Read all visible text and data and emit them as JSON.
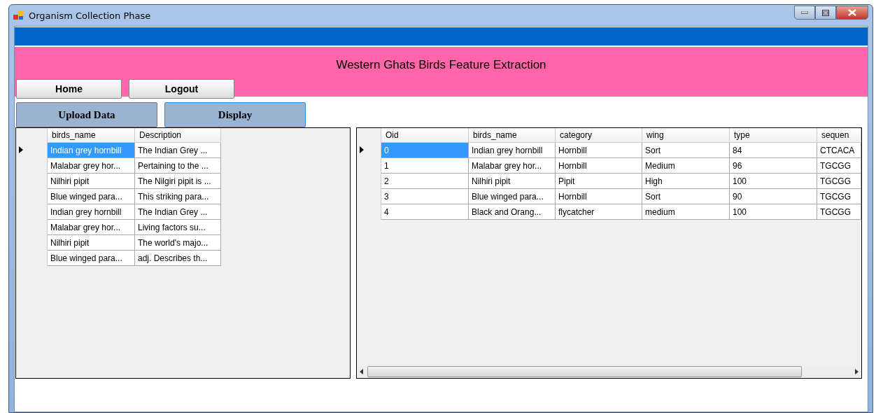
{
  "window": {
    "title": "Organism Collection Phase"
  },
  "header": {
    "title": "Western Ghats Birds Feature Extraction"
  },
  "nav_buttons": [
    "Home",
    "Logout"
  ],
  "action_buttons": [
    "Upload Data",
    "Display"
  ],
  "left_table": {
    "columns": [
      "birds_name",
      "Description"
    ],
    "rows": [
      {
        "selected": true,
        "cells": [
          "Indian grey hornbill",
          "The Indian Grey ..."
        ]
      },
      {
        "selected": false,
        "cells": [
          "Malabar grey hor...",
          "Pertaining to the ..."
        ]
      },
      {
        "selected": false,
        "cells": [
          "Nilhiri pipit",
          "The Nilgiri pipit is ..."
        ]
      },
      {
        "selected": false,
        "cells": [
          "Blue winged para...",
          "This striking para..."
        ]
      },
      {
        "selected": false,
        "cells": [
          "Indian grey hornbill",
          "The Indian Grey ..."
        ]
      },
      {
        "selected": false,
        "cells": [
          "Malabar grey hor...",
          "Living factors su..."
        ]
      },
      {
        "selected": false,
        "cells": [
          "Nilhiri pipit",
          "The world's majo..."
        ]
      },
      {
        "selected": false,
        "cells": [
          "Blue winged para...",
          "adj. Describes th..."
        ]
      }
    ]
  },
  "right_table": {
    "columns": [
      "Oid",
      "birds_name",
      "category",
      "wing",
      "type",
      "sequen"
    ],
    "rows": [
      {
        "selected": true,
        "cells": [
          "0",
          "Indian grey hornbill",
          "Hornbill",
          "Sort",
          "84",
          "CTCACA"
        ]
      },
      {
        "selected": false,
        "cells": [
          "1",
          "Malabar grey hor...",
          "Hornbill",
          "Medium",
          "96",
          "TGCGG"
        ]
      },
      {
        "selected": false,
        "cells": [
          "2",
          "Nilhiri pipit",
          "Pipit",
          "High",
          "100",
          "TGCGG"
        ]
      },
      {
        "selected": false,
        "cells": [
          "3",
          "Blue winged para...",
          "Hornbill",
          "Sort",
          "90",
          "TGCGG"
        ]
      },
      {
        "selected": false,
        "cells": [
          "4",
          "Black and Orang...",
          "flycatcher",
          "medium",
          "100",
          "TGCGG"
        ]
      }
    ]
  }
}
